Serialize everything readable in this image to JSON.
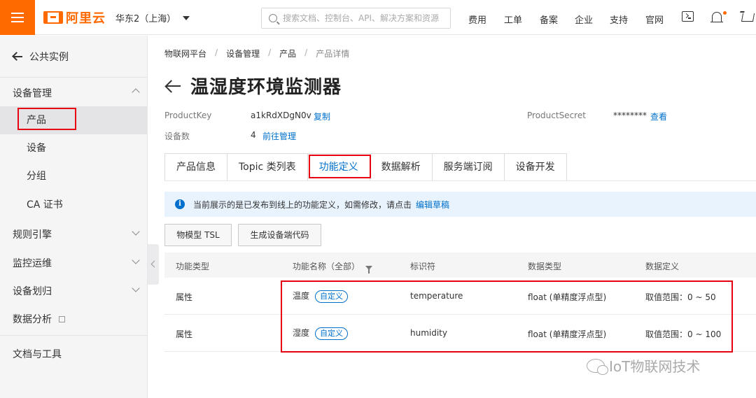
{
  "header": {
    "logo_text": "阿里云",
    "region": "华东2（上海）",
    "search_placeholder": "搜索文档、控制台、API、解决方案和资源",
    "nav": [
      "费用",
      "工单",
      "备案",
      "企业",
      "支持",
      "官网"
    ],
    "icons": [
      "menu-icon",
      "terminal-icon",
      "bell-icon",
      "cart-icon"
    ],
    "accent_color": "#ff6a00"
  },
  "sidebar": {
    "back_label": "公共实例",
    "groups": [
      {
        "label": "设备管理",
        "expanded": true,
        "items": [
          "产品",
          "设备",
          "分组",
          "CA 证书"
        ]
      },
      {
        "label": "规则引擎",
        "expanded": false
      },
      {
        "label": "监控运维",
        "expanded": false
      },
      {
        "label": "设备划归",
        "expanded": false
      },
      {
        "label": "数据分析",
        "expanded": false
      }
    ],
    "active_item": "产品",
    "docs_label": "文档与工具"
  },
  "breadcrumb": [
    "物联网平台",
    "设备管理",
    "产品",
    "产品详情"
  ],
  "page": {
    "title": "温湿度环境监测器",
    "product_key_label": "ProductKey",
    "product_key_value": "a1kRdXDgN0v",
    "copy_link": "复制",
    "product_secret_label": "ProductSecret",
    "product_secret_value": "********",
    "view_link": "查看",
    "device_count_label": "设备数",
    "device_count_value": "4",
    "manage_link": "前往管理"
  },
  "tabs": [
    "产品信息",
    "Topic 类列表",
    "功能定义",
    "数据解析",
    "服务端订阅",
    "设备开发"
  ],
  "active_tab": "功能定义",
  "notice": {
    "text": "当前展示的是已发布到线上的功能定义，如需修改，请点击",
    "link": "编辑草稿"
  },
  "buttons": {
    "tsl": "物模型 TSL",
    "gen_code": "生成设备端代码"
  },
  "table": {
    "headers": [
      "功能类型",
      "功能名称（全部）",
      "标识符",
      "数据类型",
      "数据定义"
    ],
    "rows": [
      {
        "type": "属性",
        "name": "温度",
        "tag": "自定义",
        "identifier": "temperature",
        "data_type": "float (单精度浮点型)",
        "definition": "取值范围：0 ~ 50"
      },
      {
        "type": "属性",
        "name": "湿度",
        "tag": "自定义",
        "identifier": "humidity",
        "data_type": "float (单精度浮点型)",
        "definition": "取值范围：0 ~ 100"
      }
    ]
  },
  "watermark": "IoT物联网技术"
}
